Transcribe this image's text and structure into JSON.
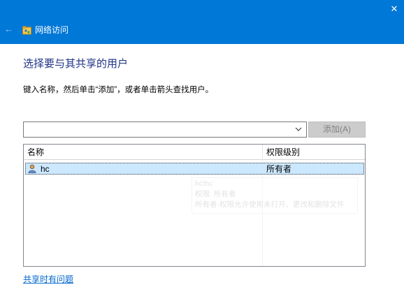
{
  "window": {
    "title": "网络访问",
    "close_label": "✕",
    "back_label": "←"
  },
  "page": {
    "heading": "选择要与其共享的用户",
    "instruction": "键入名称，然后单击“添加”，或者单击箭头查找用户。"
  },
  "picker": {
    "input_value": "",
    "add_label": "添加(A)"
  },
  "list": {
    "columns": [
      "名称",
      "权限级别"
    ],
    "rows": [
      {
        "name": "hc",
        "permission": "所有者"
      }
    ],
    "ghost_tooltip": [
      "hc\\hc",
      "权限: 所有者",
      "所有者-权限允许使用未打开、更改和删除文件"
    ]
  },
  "footer": {
    "help_link": "共享时有问题"
  },
  "colors": {
    "titlebar": "#0078d7",
    "heading": "#1e3287",
    "selection": "#cce8ff",
    "link": "#0066cc",
    "disabled_button": "#cccccc"
  }
}
